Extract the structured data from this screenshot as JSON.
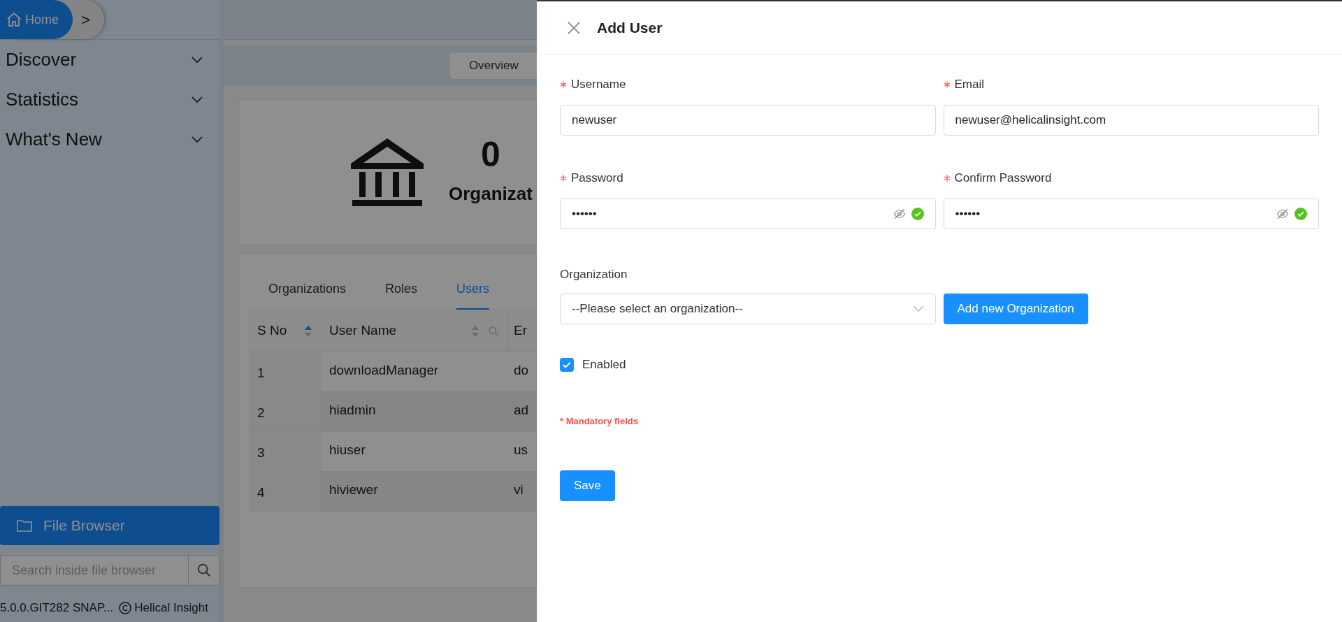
{
  "breadcrumb": {
    "home": "Home",
    "separator": ">"
  },
  "sidebar": {
    "items": [
      {
        "label": "Discover"
      },
      {
        "label": "Statistics"
      },
      {
        "label": "What's New"
      }
    ],
    "file_browser": "File Browser",
    "search": {
      "placeholder": "Search inside file browser"
    },
    "footer": {
      "version": "5.0.0.GIT282 SNAP...",
      "brand": "Helical Insight"
    }
  },
  "main": {
    "overview_button": "Overview",
    "stat": {
      "value": "0",
      "label": "Organizat"
    },
    "tabs": [
      {
        "label": "Organizations",
        "selected": false
      },
      {
        "label": "Roles",
        "selected": false
      },
      {
        "label": "Users",
        "selected": true
      }
    ],
    "table": {
      "columns": [
        {
          "label": "S No",
          "sorted": true
        },
        {
          "label": "User Name",
          "sorted": false,
          "filter": true
        },
        {
          "label": "Er"
        }
      ],
      "rows": [
        {
          "cells": [
            "1",
            "downloadManager",
            "do"
          ]
        },
        {
          "cells": [
            "2",
            "hiadmin",
            "ad"
          ]
        },
        {
          "cells": [
            "3",
            "hiuser",
            "us"
          ]
        },
        {
          "cells": [
            "4",
            "hiviewer",
            "vi"
          ]
        }
      ]
    }
  },
  "drawer": {
    "title": "Add User",
    "fields": [
      {
        "label": "Username",
        "required": true,
        "value": "newuser",
        "kind": "text"
      },
      {
        "label": "Email",
        "required": true,
        "value": "newuser@helicalinsight.com",
        "kind": "text"
      },
      {
        "label": "Password",
        "required": true,
        "value": "••••••",
        "kind": "password",
        "valid": true
      },
      {
        "label": "Confirm Password",
        "required": true,
        "value": "••••••",
        "kind": "password",
        "valid": true
      }
    ],
    "organization": {
      "label": "Organization",
      "value": "--Please select an organization--",
      "add_button": "Add new Organization"
    },
    "enabled": {
      "label": "Enabled",
      "checked": true
    },
    "mandatory_note": "* Mandatory fields",
    "save_button": "Save"
  }
}
